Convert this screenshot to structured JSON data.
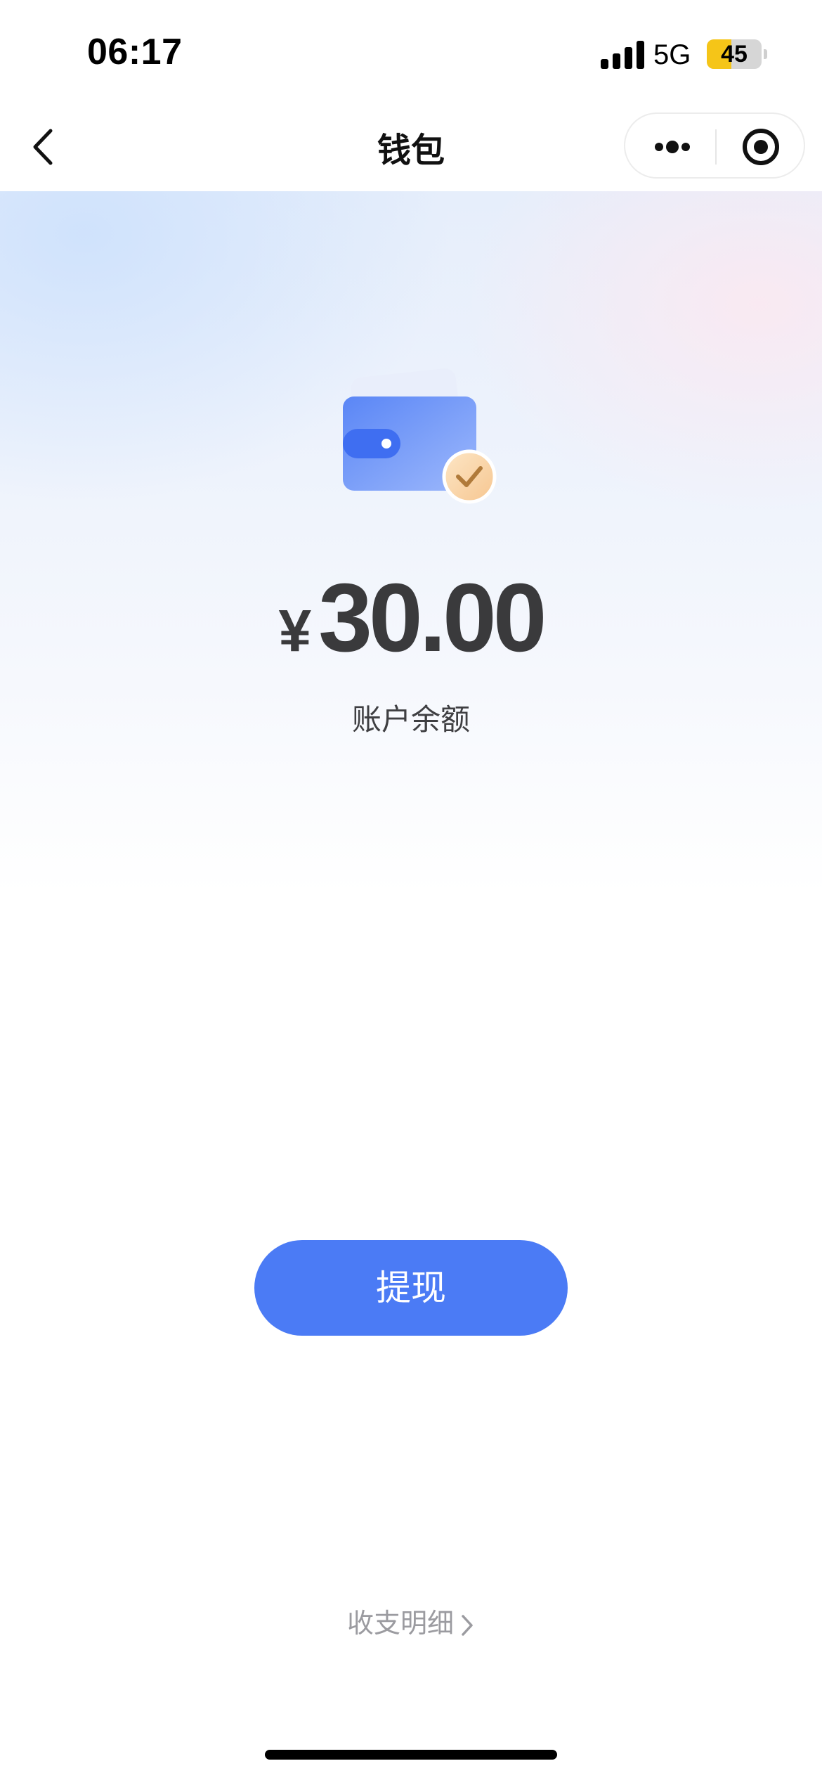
{
  "status_bar": {
    "time": "06:17",
    "network": "5G",
    "battery_level": "45",
    "battery_fraction": 0.45,
    "battery_color": "#f5c518"
  },
  "nav": {
    "title": "钱包",
    "back_icon": "chevron-left-icon",
    "more_icon": "more-dots-icon",
    "close_icon": "target-circle-icon"
  },
  "wallet": {
    "icon": "wallet-check-icon",
    "currency_symbol": "¥",
    "balance": "30.00",
    "balance_label": "账户余额"
  },
  "actions": {
    "withdraw_label": "提现",
    "withdraw_color": "#4b7bf5",
    "details_label": "收支明细"
  }
}
